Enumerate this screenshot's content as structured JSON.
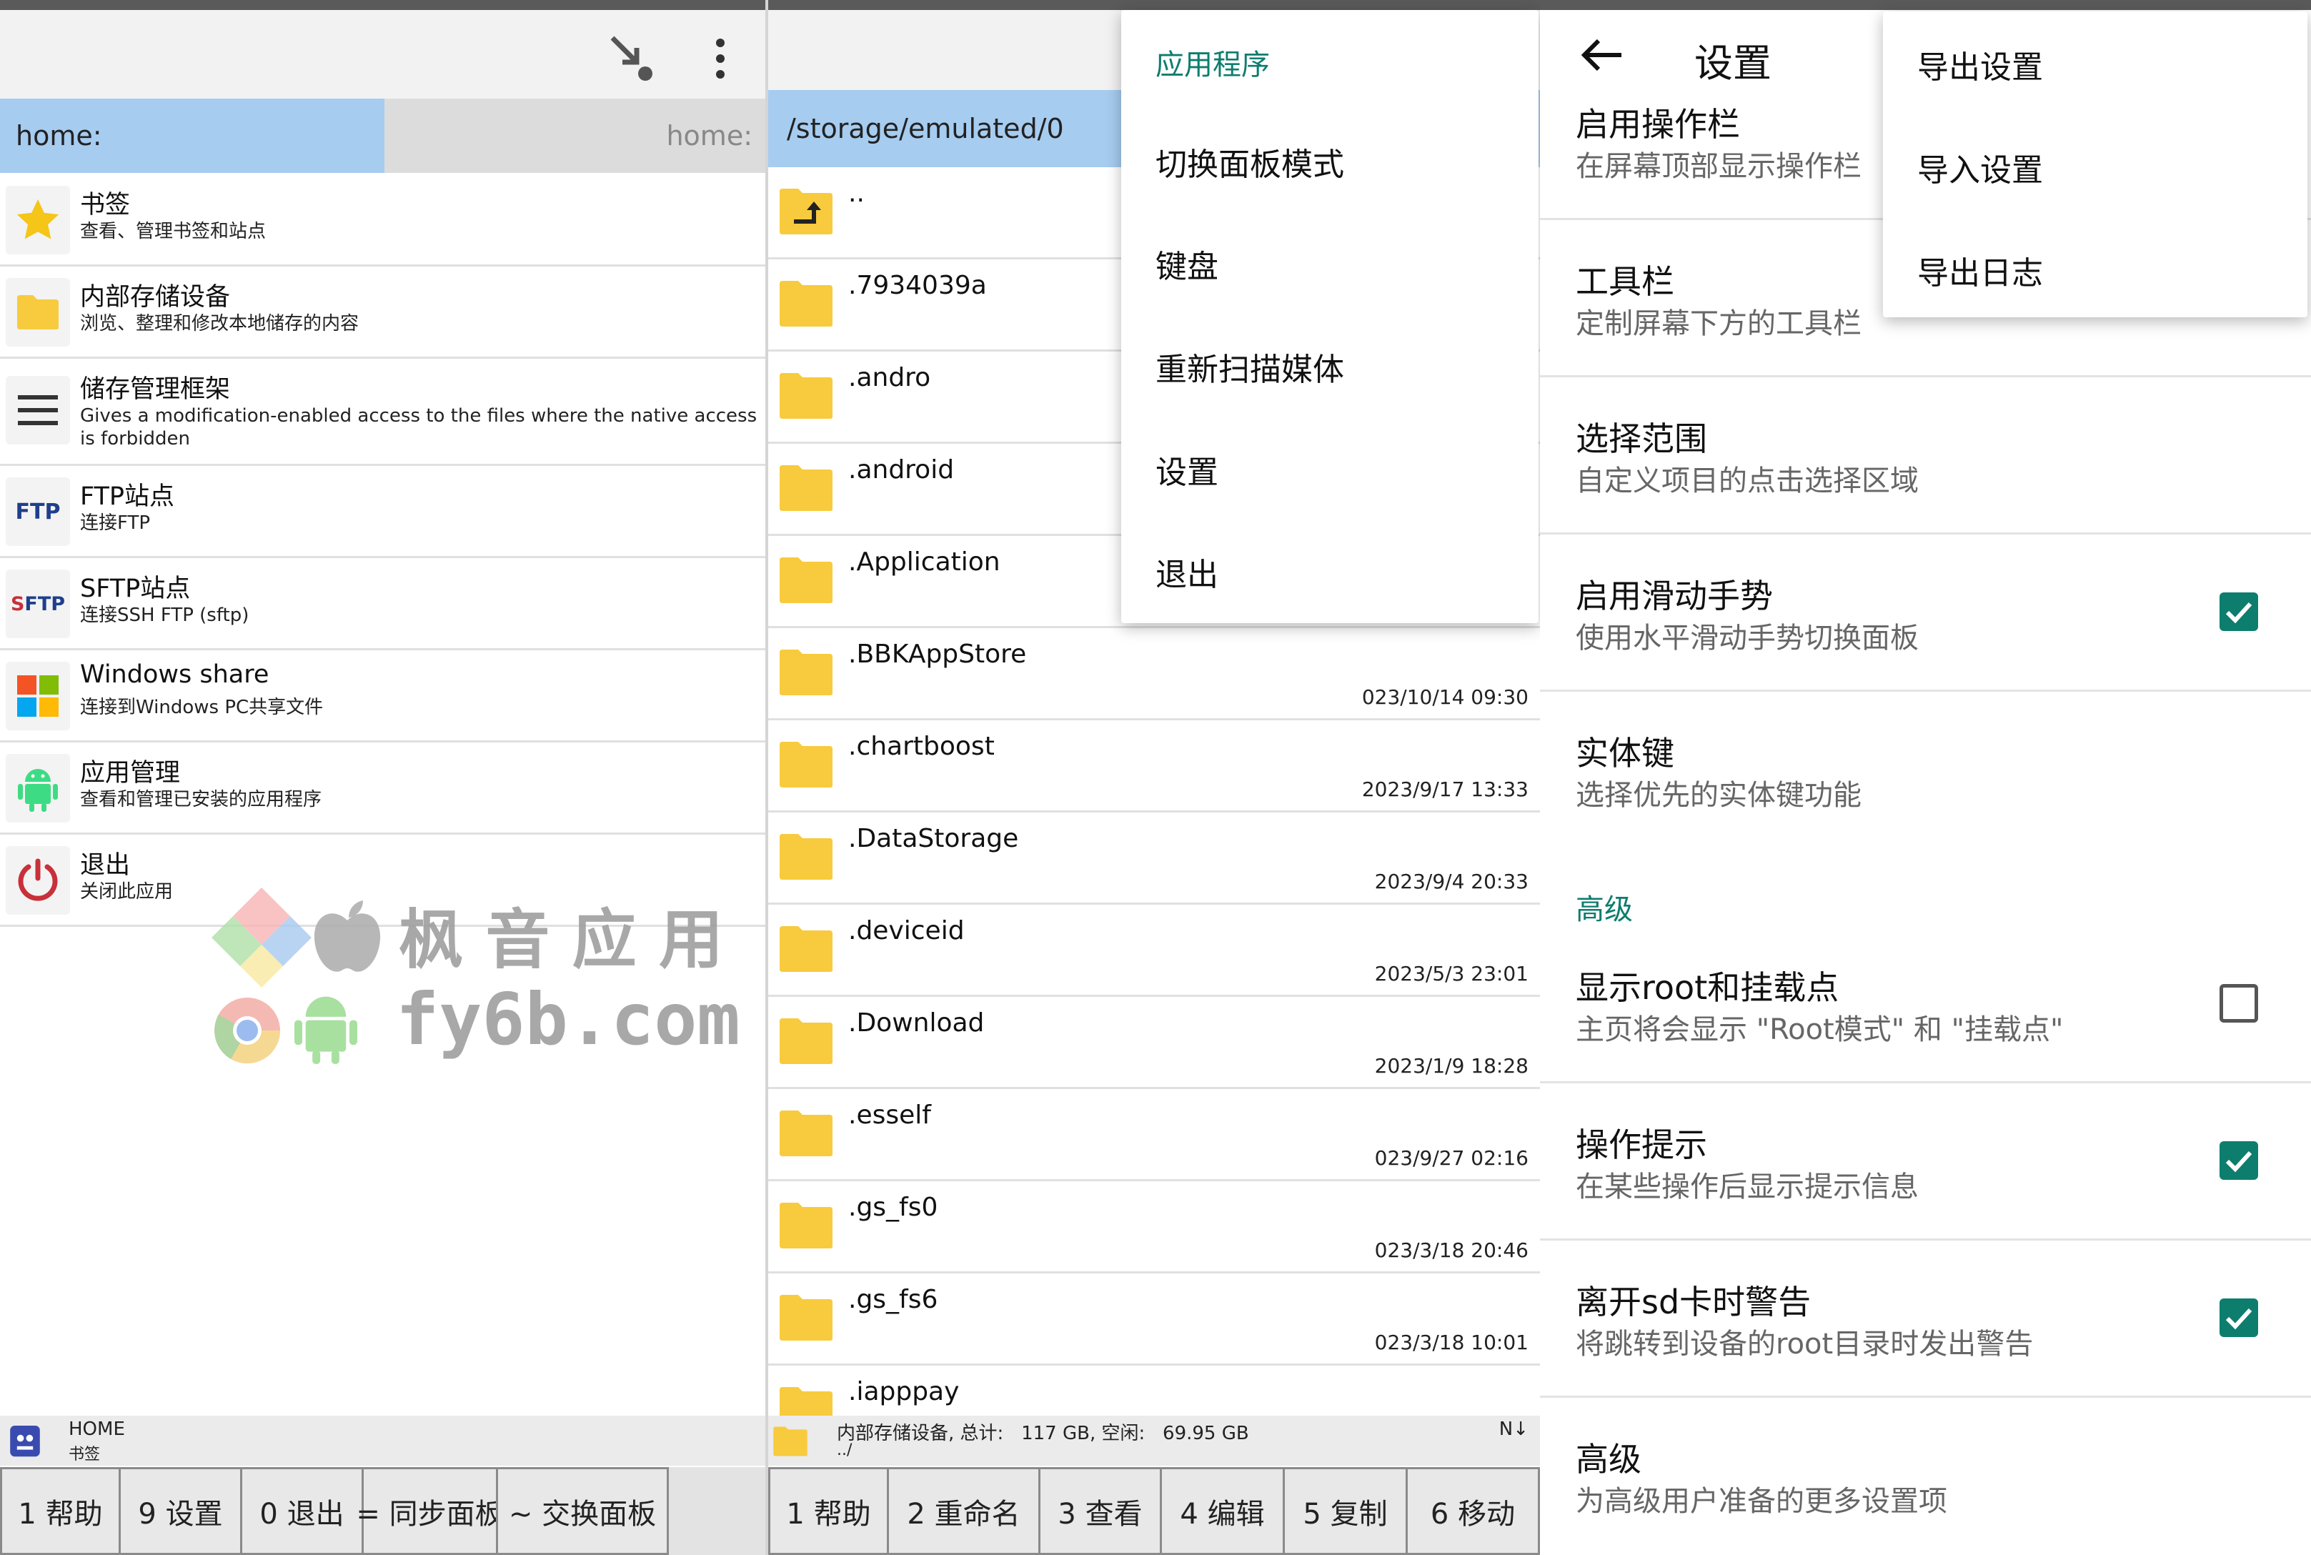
{
  "colors": {
    "accent": "#0d7d6e",
    "path_active": "#a6ccf0",
    "star": "#f5c518",
    "folder": "#f7cb3d",
    "android": "#3ddc84",
    "power": "#c8303a"
  },
  "left": {
    "path_active": "home:",
    "path_inactive": "home:",
    "items": [
      {
        "title": "书签",
        "sub": "查看、管理书签和站点",
        "icon": "star-icon"
      },
      {
        "title": "内部存储设备",
        "sub": "浏览、整理和修改本地储存的内容",
        "icon": "folder-icon"
      },
      {
        "title": "储存管理框架",
        "sub": "Gives a modification-enabled access to the files where the native access is forbidden",
        "icon": "menu-lines-icon"
      },
      {
        "title": "FTP站点",
        "sub": "连接FTP",
        "icon": "ftp-icon",
        "badge": "FTP"
      },
      {
        "title": "SFTP站点",
        "sub": "连接SSH FTP (sftp)",
        "icon": "sftp-icon",
        "badge": "SFTP"
      },
      {
        "title": "Windows share",
        "sub": "连接到Windows PC共享文件",
        "icon": "windows-icon"
      },
      {
        "title": "应用管理",
        "sub": "查看和管理已安装的应用程序",
        "icon": "android-icon"
      },
      {
        "title": "退出",
        "sub": "关闭此应用",
        "icon": "power-icon"
      }
    ],
    "status": {
      "title": "HOME",
      "sub": "书签"
    },
    "fkeys": [
      "1 帮助",
      "9 设置",
      "0 退出",
      "= 同步面板",
      "~ 交换面板"
    ]
  },
  "watermark": {
    "cn": "枫 音 应 用",
    "en": "fy6b.com"
  },
  "middle": {
    "path": "/storage/emulated/0",
    "parent": "..",
    "files": [
      {
        "name": ".7934039a",
        "date": ""
      },
      {
        "name": ".andro",
        "date": ""
      },
      {
        "name": ".android",
        "date": ""
      },
      {
        "name": ".Application",
        "date": ""
      },
      {
        "name": ".BBKAppStore",
        "date": "023/10/14 09:30"
      },
      {
        "name": ".chartboost",
        "date": "2023/9/17 13:33"
      },
      {
        "name": ".DataStorage",
        "date": "2023/9/4 20:33"
      },
      {
        "name": ".deviceid",
        "date": "2023/5/3 23:01"
      },
      {
        "name": ".Download",
        "date": "2023/1/9 18:28"
      },
      {
        "name": ".esself",
        "date": "023/9/27 02:16"
      },
      {
        "name": ".gs_fs0",
        "date": "023/3/18 20:46"
      },
      {
        "name": ".gs_fs6",
        "date": "023/3/18 10:01"
      },
      {
        "name": ".iapppay",
        "date": ""
      }
    ],
    "status": {
      "line1": "内部存储设备, 总计:   117 GB, 空闲:   69.95 GB",
      "line2": "../",
      "sort": "N↓"
    },
    "fkeys": [
      "1 帮助",
      "2 重命名",
      "3 查看",
      "4 编辑",
      "5 复制",
      "6 移动"
    ],
    "menu": {
      "header": "应用程序",
      "items": [
        "切换面板模式",
        "键盘",
        "重新扫描媒体",
        "设置",
        "退出"
      ]
    }
  },
  "settings": {
    "title": "设置",
    "rows": [
      {
        "title": "启用操作栏",
        "sub": "在屏幕顶部显示操作栏"
      },
      {
        "title": "工具栏",
        "sub": "定制屏幕下方的工具栏"
      },
      {
        "title": "选择范围",
        "sub": "自定义项目的点击选择区域"
      },
      {
        "title": "启用滑动手势",
        "sub": "使用水平滑动手势切换面板",
        "checked": true
      },
      {
        "title": "实体键",
        "sub": "选择优先的实体键功能"
      },
      {
        "title": "显示root和挂载点",
        "sub": "主页将会显示 \"Root模式\" 和 \"挂载点\"",
        "checked": false
      },
      {
        "title": "操作提示",
        "sub": "在某些操作后显示提示信息",
        "checked": true
      },
      {
        "title": "离开sd卡时警告",
        "sub": "将跳转到设备的root目录时发出警告",
        "checked": true
      },
      {
        "title": "高级",
        "sub": "为高级用户准备的更多设置项"
      }
    ],
    "section": "高级",
    "menu": [
      "导出设置",
      "导入设置",
      "导出日志"
    ]
  }
}
